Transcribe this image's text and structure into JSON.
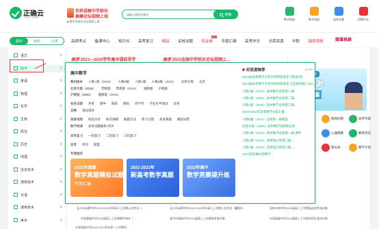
{
  "header": {
    "logo_name": "正确云",
    "logo_sub": "ZQY.COM",
    "promo_line1": "名师讲解中学校长",
    "promo_line2": "高峰论坛视频上线",
    "promo_sub_hot": "■",
    "promo_sub": "数中学校长论坛视频上线",
    "search_placeholder": "请输入搜索关键词",
    "search_button": "搜索",
    "icons": [
      {
        "label": "数字校园",
        "icon": "school-icon",
        "color": "#2fb36b"
      },
      {
        "label": "数字校园",
        "icon": "campus-icon",
        "color": "#f6a623"
      },
      {
        "label": "高考试题",
        "icon": "exam-icon",
        "color": "#3b8fe8"
      },
      {
        "label": "招聘平台",
        "icon": "recruit-icon",
        "color": "#e8333a"
      }
    ]
  },
  "nav": {
    "levels": [
      "高中",
      "初中",
      "小学"
    ],
    "items": [
      {
        "label": "高频考点",
        "badge": ""
      },
      {
        "label": "备课中心",
        "badge": ""
      },
      {
        "label": "知识点",
        "badge": ""
      },
      {
        "label": "高考复习",
        "badge": ""
      },
      {
        "label": "精品",
        "badge": "",
        "red": true
      },
      {
        "label": "名校试题",
        "badge": ""
      },
      {
        "label": "机会卷",
        "badge": "HOT",
        "red": true
      },
      {
        "label": "专题汇编",
        "badge": ""
      },
      {
        "label": "高考作文",
        "badge": ""
      },
      {
        "label": "文库资源",
        "badge": ""
      },
      {
        "label": "中职",
        "badge": ""
      },
      {
        "label": "独家视频",
        "badge": "",
        "red": true
      }
    ],
    "brand": "猎课系统"
  },
  "sidebar": {
    "items": [
      {
        "label": "语文",
        "active": false
      },
      {
        "label": "数学",
        "active": true
      },
      {
        "label": "英语",
        "active": false
      },
      {
        "label": "物理",
        "active": false
      },
      {
        "label": "化学",
        "active": false
      },
      {
        "label": "生物",
        "active": false
      },
      {
        "label": "政治",
        "active": false
      },
      {
        "label": "历史",
        "active": false
      },
      {
        "label": "地理",
        "active": false
      },
      {
        "label": "信息技术",
        "active": false
      },
      {
        "label": "通用技术",
        "active": false
      },
      {
        "label": "日语",
        "active": false
      },
      {
        "label": "通用技术",
        "active": false
      },
      {
        "label": "美术",
        "active": false
      }
    ]
  },
  "main": {
    "headlines": [
      {
        "tag": "推荐",
        "text": "2023—2024学年高中课前导学"
      },
      {
        "tag": "推荐",
        "text": "2023全国中学校长论坛视频上..."
      }
    ],
    "bottom_links": [
      "长沙市长郡中学2023-2024学年高二上学期入学考试（...",
      "长沙市长郡中学2023-2024学年高二上学期入学考试（暑假作...",
      "深圳市南中学2024届高三上学期届适应性测试卷",
      "许昌高级中学2024届高三上学期期中测试（…",
      "淮河市高级中学2024届高三上学期高考复试卷",
      "许昌高级中学2024届高三上学期合招生测试试卷",
      "许昌高级中学2022-2023学年高一上学期合..."
    ]
  },
  "right_panel": {
    "banner_year": "2021-2023年",
    "banner_big": "新高考",
    "banner_sub": "真题精编",
    "services": [
      {
        "label": "每周好题",
        "icon": "weekly-icon",
        "color": "#f6a623"
      },
      {
        "label": "高考专题",
        "icon": "topic-icon",
        "color": "#2fb36b"
      },
      {
        "label": "心理健康",
        "icon": "mind-icon",
        "color": "#3b8fe8"
      },
      {
        "label": "教育资讯",
        "icon": "news-icon",
        "color": "#19b86b"
      },
      {
        "label": "家长会",
        "icon": "parent-icon",
        "color": "#e8333a"
      },
      {
        "label": "教学计划",
        "icon": "plan-icon",
        "color": "#f6a623"
      }
    ]
  },
  "popup": {
    "title": "高中数学",
    "lines": [
      [
        "教材版本",
        "人教A版（2019）",
        "人教B版",
        "人教A版",
        "人教B版（2019）",
        "北师大版",
        "北京"
      ],
      [
        "北师大版（2019）",
        "苏教版",
        "苏教版（2019）",
        "湘教版",
        "沪教版"
      ],
      [
        "沪教版（2020）",
        "湘教版（2019）"
      ],
      [
        "名校试题",
        "月考",
        "期中",
        "期末",
        "模拟",
        "开学考",
        "学业水平测试",
        "高考"
      ],
      [
        "竞赛",
        "强化培优"
      ],
      [
        "独家视频",
        "经验分享",
        "知识讲解",
        "解题方法",
        "练习习题",
        "高考真题",
        "模拟试卷"
      ],
      [
        "数学微课",
        "高考试题解析/点评"
      ],
      [
        "高考复习",
        "一轮复习",
        "二轮复习",
        "三轮复习"
      ],
      [
        "高考",
        "考点",
        "题型"
      ],
      [
        "专题推荐"
      ]
    ],
    "cards": [
      {
        "a": "2021年真题",
        "b": "数学真题模拟试题",
        "c": "专项汇编",
        "color1": "#ffb35c",
        "color2": "#ff7a2b"
      },
      {
        "a": "2021-2023年",
        "b": "新高考数学真题",
        "c": "",
        "color1": "#4f8cf7",
        "color2": "#2a5fd8"
      },
      {
        "a": "2023年高中",
        "b": "数学竞赛提升练",
        "c": "",
        "color1": "#6ea8ff",
        "color2": "#3b6fe0"
      }
    ],
    "right_title": "好资源推荐",
    "right_more": "MORE",
    "right_items": [
      "2024届高考数学大单元每周提高卷【新高考】",
      "2024届高考数学大单元每周提高卷【全国卷版】2024...",
      "人教A版（2019）高中数学必修第一册...",
      "人教A版（2019）高中数学必修第二册...",
      "人教A版（2019）高中数学必修第三册...",
      "2019-2022年高考数学分类汇编",
      "人教B版（2019）必修第一册教案",
      "北师大版（2019）高中数学选择性必修...",
      "人教A版（2019）高中数学必修第一册 课件",
      "人教A版（2019）选择性必修第二册...",
      "人教A版（2019）选择性必修第三册...",
      "2023年新课标卷数学..."
    ]
  },
  "colors": {
    "brand_green": "#19b86b",
    "accent_red": "#e8333a"
  }
}
